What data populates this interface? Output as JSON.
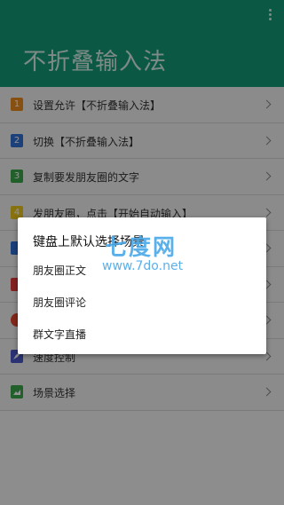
{
  "header": {
    "title": "不折叠输入法"
  },
  "menu_icon": "more-vert-icon",
  "rows": [
    {
      "num": "1",
      "label": "设置允许【不折叠输入法】",
      "color": "#e98b1c",
      "icon": "step-1-icon"
    },
    {
      "num": "2",
      "label": "切换【不折叠输入法】",
      "color": "#2f6fd3",
      "icon": "step-2-icon"
    },
    {
      "num": "3",
      "label": "复制要发朋友圈的文字",
      "color": "#3aa54a",
      "icon": "step-3-icon"
    },
    {
      "num": "4",
      "label": "发朋友圈，点击【开始自动输入】",
      "color": "#e8c51c",
      "icon": "step-4-icon"
    },
    {
      "num": "",
      "label": "",
      "color": "#2f6fd3",
      "icon": "blue-tile-icon"
    },
    {
      "num": "",
      "label": "",
      "color": "#e33a3a",
      "icon": "red-tile-icon"
    },
    {
      "num": "",
      "label": "",
      "color": "#e2452e",
      "icon": "red-circle-icon"
    },
    {
      "num": "",
      "label": "速度控制",
      "color": "#4a58c8",
      "icon": "rocket-icon"
    },
    {
      "num": "",
      "label": "场景选择",
      "color": "#3aa54a",
      "icon": "scene-icon"
    }
  ],
  "dialog": {
    "title": "键盘上默认选择场景",
    "options": [
      "朋友圈正文",
      "朋友圈评论",
      "群文字直播"
    ]
  },
  "watermark": {
    "line1": "七度网",
    "line2": "www.7do.net"
  }
}
